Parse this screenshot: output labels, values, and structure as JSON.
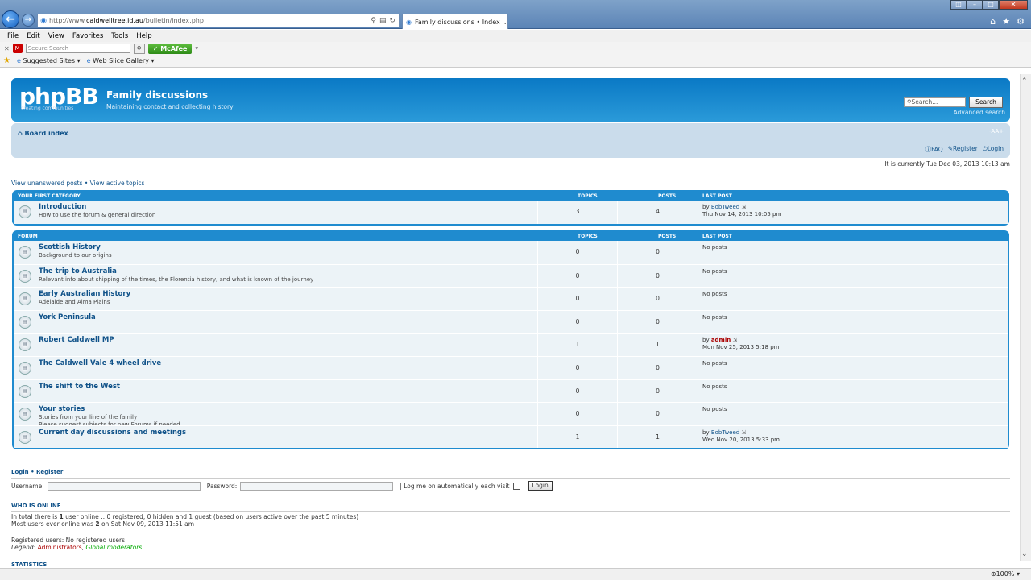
{
  "browser": {
    "url_prefix": "http://www.",
    "url_host": "caldwelltree.id.au",
    "url_path": "/bulletin/index.php",
    "tab_title": "Family discussions • Index ...",
    "menu": [
      "File",
      "Edit",
      "View",
      "Favorites",
      "Tools",
      "Help"
    ],
    "secure_search_placeholder": "Secure Search",
    "mcafee_label": "McAfee",
    "favorites": [
      "Suggested Sites ▾",
      "Web Slice Gallery ▾"
    ],
    "zoom": "100%"
  },
  "header": {
    "logo": "phpBB",
    "logo_tag": "creating   communities",
    "title": "Family discussions",
    "description": "Maintaining contact and collecting history",
    "search_placeholder": "Search...",
    "search_button": "Search",
    "advanced_search": "Advanced search"
  },
  "nav": {
    "board_index": "Board index",
    "font_size": "-AA+",
    "faq": "FAQ",
    "register": "Register",
    "login": "Login"
  },
  "current_time": "It is currently Tue Dec 03, 2013 10:13 am",
  "quicklinks": "View unanswered posts • View active topics",
  "categories": [
    {
      "name": "Your first category",
      "col_topics": "Topics",
      "col_posts": "Posts",
      "col_last": "Last post",
      "forums": [
        {
          "title": "Introduction",
          "desc": [
            "How to use the forum & general direction"
          ],
          "topics": "3",
          "posts": "4",
          "last_by": "by ",
          "last_user": "BobTweed",
          "last_time": "Thu Nov 14, 2013 10:05 pm",
          "no_posts": ""
        }
      ]
    },
    {
      "name": "Forum",
      "col_topics": "Topics",
      "col_posts": "Posts",
      "col_last": "Last post",
      "forums": [
        {
          "title": "Scottish History",
          "desc": [
            "Background to our origins"
          ],
          "topics": "0",
          "posts": "0",
          "no_posts": "No posts"
        },
        {
          "title": "The trip to Australia",
          "desc": [
            "Relevant info about shipping of the times, the Florentia history, and what is known of the journey"
          ],
          "topics": "0",
          "posts": "0",
          "no_posts": "No posts"
        },
        {
          "title": "Early Australian History",
          "desc": [
            "Adelaide and Alma Plains"
          ],
          "topics": "0",
          "posts": "0",
          "no_posts": "No posts"
        },
        {
          "title": "York Peninsula",
          "desc": [],
          "topics": "0",
          "posts": "0",
          "no_posts": "No posts"
        },
        {
          "title": "Robert Caldwell MP",
          "desc": [],
          "topics": "1",
          "posts": "1",
          "last_by": "by ",
          "last_user": "admin",
          "last_admin": true,
          "last_time": "Mon Nov 25, 2013 5:18 pm",
          "no_posts": ""
        },
        {
          "title": "The Caldwell Vale 4 wheel drive",
          "desc": [],
          "topics": "0",
          "posts": "0",
          "no_posts": "No posts"
        },
        {
          "title": "The shift to the West",
          "desc": [],
          "topics": "0",
          "posts": "0",
          "no_posts": "No posts"
        },
        {
          "title": "Your stories",
          "desc": [
            "Stories from your line of the family",
            "Please suggest subjects for new Forums if needed"
          ],
          "topics": "0",
          "posts": "0",
          "no_posts": "No posts"
        },
        {
          "title": "Current day discussions and meetings",
          "desc": [],
          "topics": "1",
          "posts": "1",
          "last_by": "by ",
          "last_user": "BobTweed",
          "last_time": "Wed Nov 20, 2013 5:33 pm",
          "no_posts": ""
        }
      ]
    }
  ],
  "login": {
    "heading": "Login • Register",
    "username_label": "Username:",
    "password_label": "Password:",
    "autologin_label": "| Log me on automatically each visit",
    "button": "Login"
  },
  "online": {
    "heading": "Who is online",
    "line1_pre": "In total there is ",
    "line1_count": "1",
    "line1_post": " user online :: 0 registered, 0 hidden and 1 guest (based on users active over the past 5 minutes)",
    "line2_pre": "Most users ever online was ",
    "line2_count": "2",
    "line2_post": " on Sat Nov 09, 2013 11:51 am",
    "registered": "Registered users: No registered users",
    "legend_label": "Legend:",
    "legend_admin": "Administrators",
    "legend_sep": ", ",
    "legend_gmod": "Global moderators"
  },
  "statistics_heading": "Statistics"
}
